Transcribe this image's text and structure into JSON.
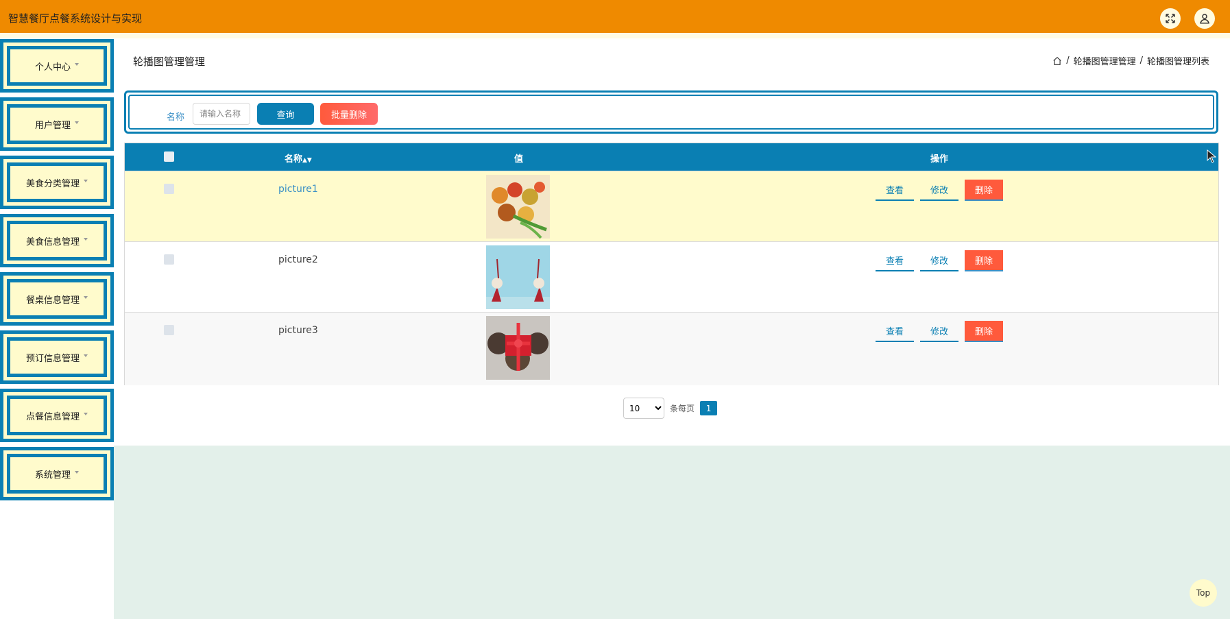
{
  "header": {
    "title": "智慧餐厅点餐系统设计与实现",
    "icons": [
      "fullscreen-icon",
      "user-icon"
    ]
  },
  "sidebar": {
    "items": [
      {
        "label": "个人中心"
      },
      {
        "label": "用户管理"
      },
      {
        "label": "美食分类管理"
      },
      {
        "label": "美食信息管理"
      },
      {
        "label": "餐桌信息管理"
      },
      {
        "label": "预订信息管理"
      },
      {
        "label": "点餐信息管理"
      },
      {
        "label": "系统管理"
      }
    ]
  },
  "main": {
    "page_title": "轮播图管理管理",
    "breadcrumb": [
      "轮播图管理管理",
      "轮播图管理列表"
    ],
    "breadcrumb_sep": "/",
    "search": {
      "label": "名称",
      "placeholder": "请输入名称",
      "query_label": "查询",
      "batch_delete_label": "批量删除"
    },
    "table": {
      "headers": {
        "name": "名称",
        "value": "值",
        "actions": "操作"
      },
      "rows": [
        {
          "name": "picture1",
          "highlight": true
        },
        {
          "name": "picture2",
          "highlight": false
        },
        {
          "name": "picture3",
          "highlight": false
        }
      ],
      "actions": {
        "view": "查看",
        "edit": "修改",
        "delete": "删除"
      }
    },
    "pagination": {
      "page_size": "10",
      "page_size_options": [
        "10"
      ],
      "per_page_text": "条每页",
      "current_page": "1"
    }
  },
  "back_to_top": "Top",
  "colors": {
    "header": "#ef8a00",
    "primary": "#0a7fb3",
    "sidebar_bg": "#fffbcc",
    "danger": "#ff5a3c",
    "row_highlight": "#fffbcc",
    "content_bg": "#e3f0ea"
  }
}
